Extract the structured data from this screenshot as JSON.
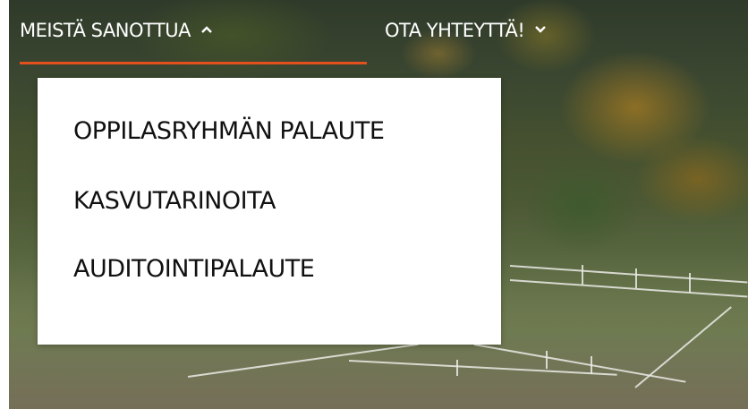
{
  "nav": {
    "items": [
      {
        "label": "Meistä sanottua",
        "expanded": true,
        "chevron_icon": "chevron-up-icon"
      },
      {
        "label": "Ota yhteyttä!",
        "expanded": false,
        "chevron_icon": "chevron-down-icon"
      }
    ],
    "active_underline_color": "#e3501e"
  },
  "dropdown": {
    "items": [
      {
        "label": "Oppilasryhmän palaute"
      },
      {
        "label": "Kasvutarinoita"
      },
      {
        "label": "Auditointipalaute"
      }
    ]
  }
}
